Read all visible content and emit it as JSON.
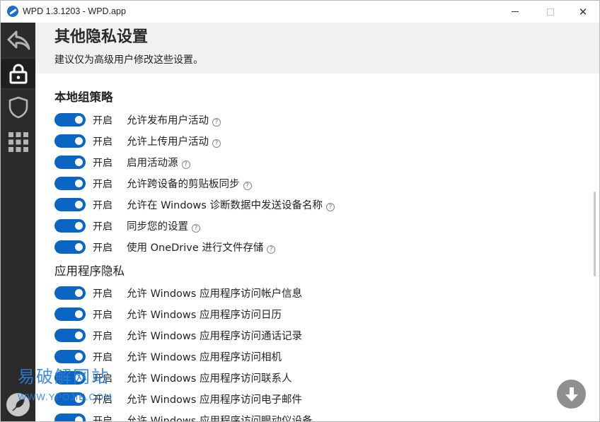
{
  "window": {
    "title": "WPD 1.3.1203 - WPD.app"
  },
  "sidebar": {
    "items": [
      {
        "name": "back",
        "icon": "back-arrow-icon"
      },
      {
        "name": "privacy",
        "icon": "lock-icon",
        "active": true
      },
      {
        "name": "security",
        "icon": "shield-icon"
      },
      {
        "name": "apps",
        "icon": "grid-icon"
      }
    ],
    "footer_icon": "wpd-logo-icon"
  },
  "header": {
    "title": "其他隐私设置",
    "subtitle": "建议仅为高级用户修改这些设置。"
  },
  "sections": [
    {
      "title": "本地组策略",
      "items": [
        {
          "state": "开启",
          "label": "允许发布用户活动",
          "help": "?",
          "on": true
        },
        {
          "state": "开启",
          "label": "允许上传用户活动",
          "help": "?",
          "on": true
        },
        {
          "state": "开启",
          "label": "启用活动源",
          "help": "?",
          "on": true
        },
        {
          "state": "开启",
          "label": "允许跨设备的剪贴板同步",
          "help": "?",
          "on": true
        },
        {
          "state": "开启",
          "label": "允许在 Windows 诊断数据中发送设备名称",
          "help": "?",
          "on": true
        },
        {
          "state": "开启",
          "label": "同步您的设置",
          "help": "?",
          "on": true
        },
        {
          "state": "开启",
          "label": "使用 OneDrive 进行文件存储",
          "help": "?",
          "on": true
        }
      ]
    },
    {
      "title": "应用程序隐私",
      "items": [
        {
          "state": "开启",
          "label": "允许 Windows 应用程序访问帐户信息",
          "on": true
        },
        {
          "state": "开启",
          "label": "允许 Windows 应用程序访问日历",
          "on": true
        },
        {
          "state": "开启",
          "label": "允许 Windows 应用程序访问通话记录",
          "on": true
        },
        {
          "state": "开启",
          "label": "允许 Windows 应用程序访问相机",
          "on": true
        },
        {
          "state": "开启",
          "label": "允许 Windows 应用程序访问联系人",
          "on": true
        },
        {
          "state": "开启",
          "label": "允许 Windows 应用程序访问电子邮件",
          "on": true
        },
        {
          "state": "开启",
          "label": "允许 Windows 应用程序访问眼动仪设备",
          "on": true
        }
      ]
    }
  ],
  "watermark": {
    "text": "易破解网站",
    "url": "WWW.YPOJIE.COM"
  },
  "colors": {
    "accent": "#0a66c2",
    "sidebar_bg": "#2b2b2b",
    "header_bg": "#f0f1f3"
  }
}
